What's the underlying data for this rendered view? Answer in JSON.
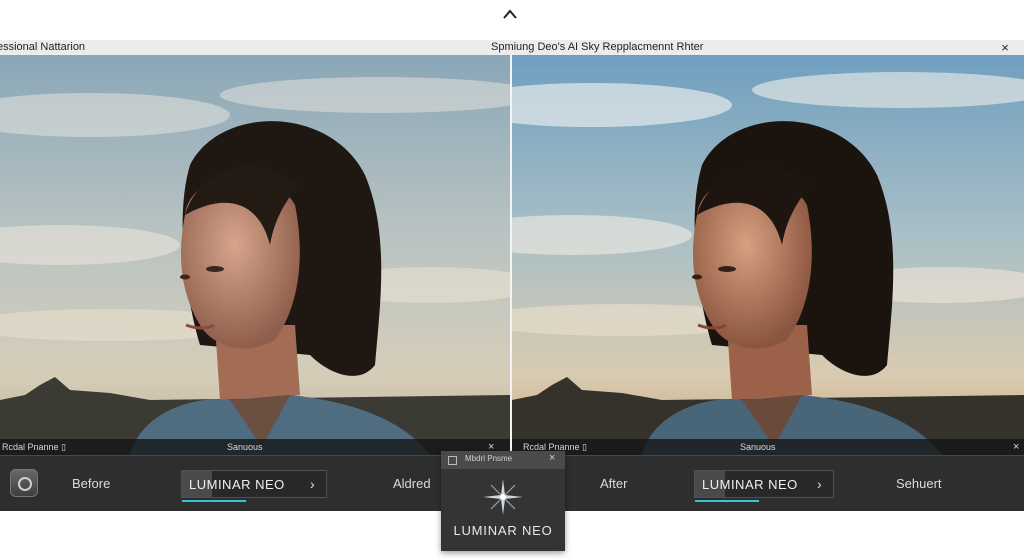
{
  "top": {
    "collapse_icon": "chevron-up-icon"
  },
  "window": {
    "left_title": "essional Nattarion",
    "center_title": "Spmiung Deo's AI Sky Repplacmennt Rhter",
    "close": "×"
  },
  "panels": {
    "left": {
      "label": "Rcdal Pnanne ▯",
      "mid": "Sanuous",
      "close": "×"
    },
    "right": {
      "label": "Rcdal Pnanne ▯",
      "mid": "Sanuous",
      "close": "×"
    }
  },
  "toolbar": {
    "before": "Before",
    "brand1": "LUMINAR NEO",
    "aldred": "Aldred",
    "after": "After",
    "brand2": "LUMINAR NEO",
    "sehuert": "Sehuert",
    "brand_chevron": "›",
    "accent": "#36c3d6"
  },
  "popup": {
    "title": "Mbdrl Pnsme",
    "close": "×",
    "brand": "LUMINAR NEO"
  }
}
